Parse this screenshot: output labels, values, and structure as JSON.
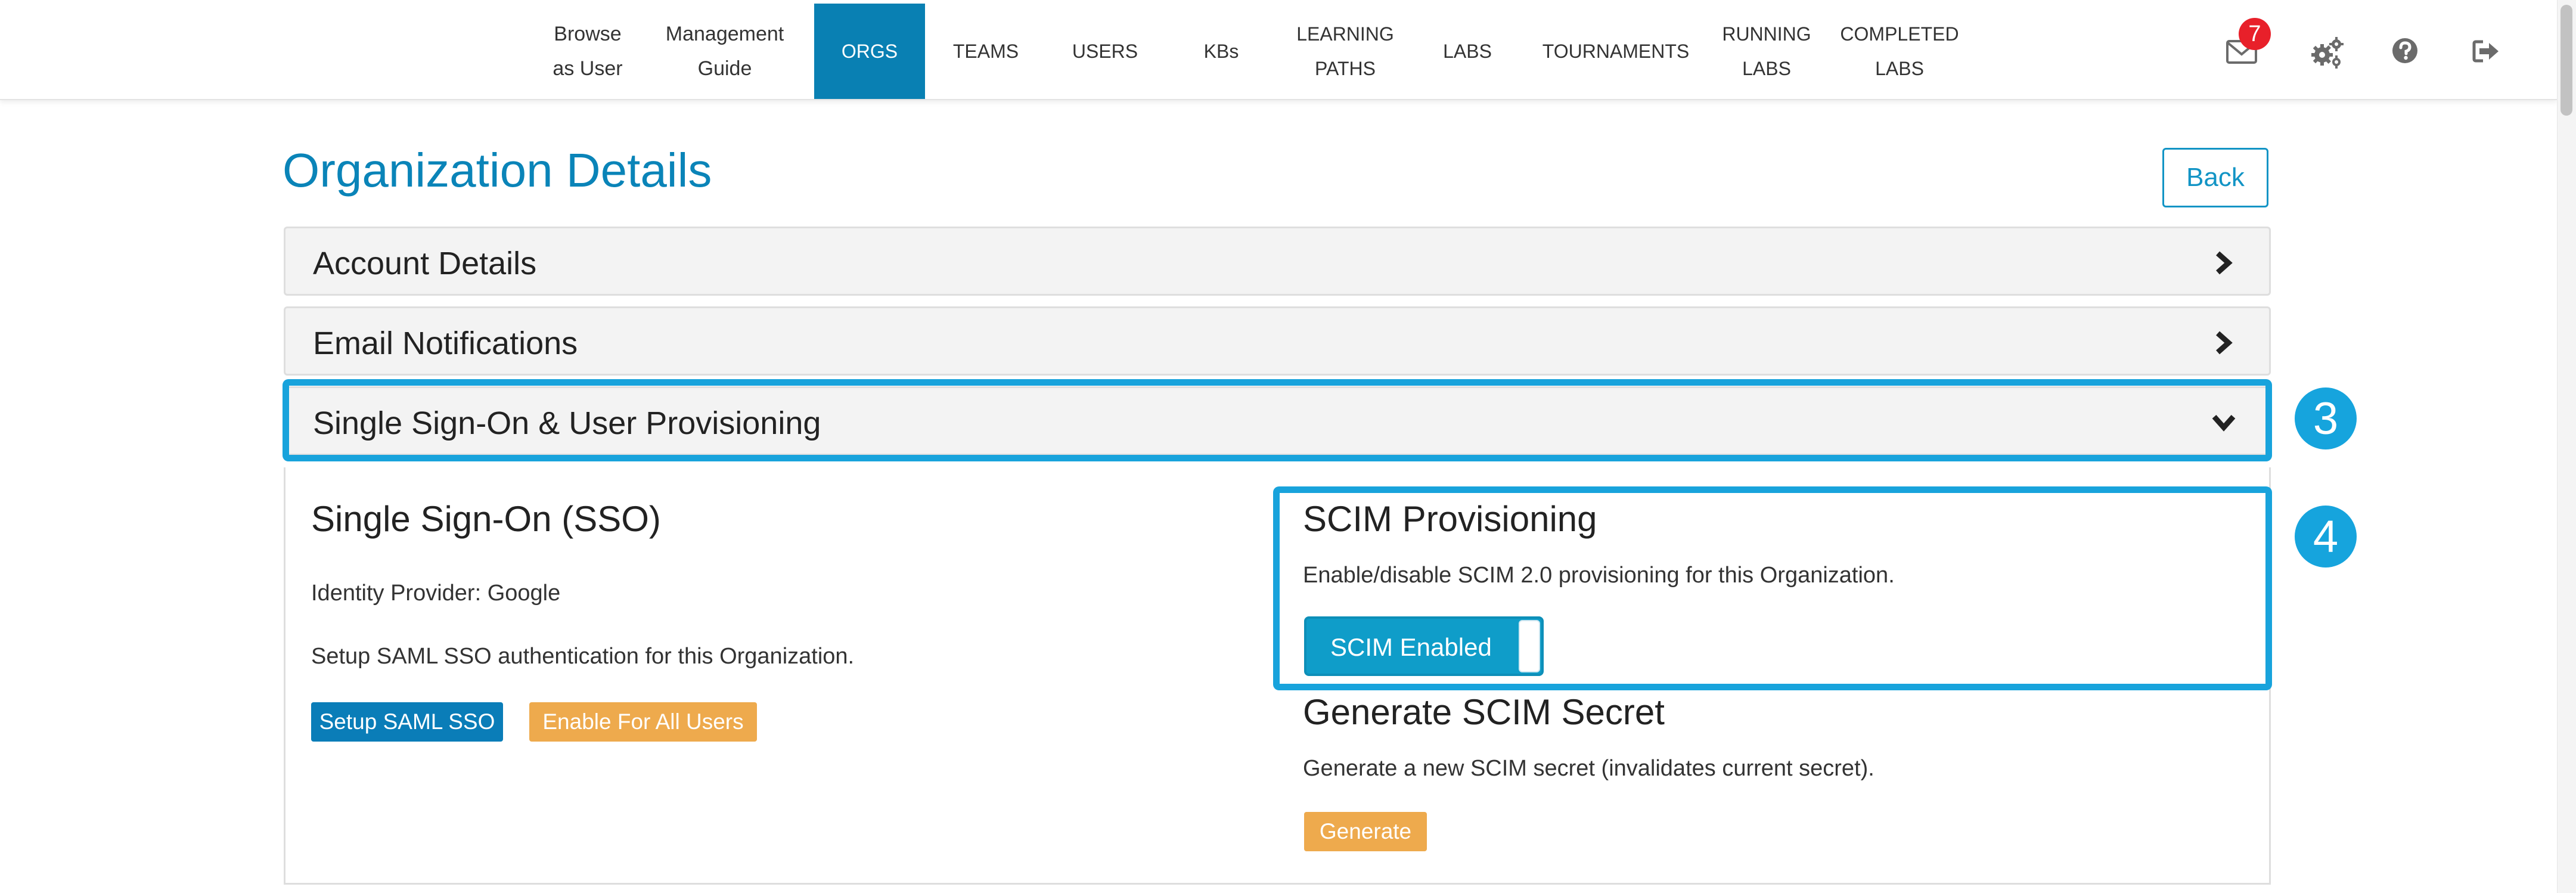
{
  "nav": {
    "items": [
      {
        "label": "Browse\nas User",
        "active": false
      },
      {
        "label": "Management\nGuide",
        "active": false
      },
      {
        "label": "ORGS",
        "active": true
      },
      {
        "label": "TEAMS",
        "active": false
      },
      {
        "label": "USERS",
        "active": false
      },
      {
        "label": "KBs",
        "active": false
      },
      {
        "label": "LEARNING\nPATHS",
        "active": false
      },
      {
        "label": "LABS",
        "active": false
      },
      {
        "label": "TOURNAMENTS",
        "active": false
      },
      {
        "label": "RUNNING\nLABS",
        "active": false
      },
      {
        "label": "COMPLETED\nLABS",
        "active": false
      }
    ],
    "mail_count": "7",
    "icons": [
      "mail-icon",
      "settings-gears-icon",
      "help-icon",
      "logout-icon"
    ],
    "active_color": "#0980b3"
  },
  "header": {
    "title": "Organization Details",
    "back_label": "Back"
  },
  "accordion": {
    "sections": [
      {
        "title": "Account Details",
        "expanded": false
      },
      {
        "title": "Email Notifications",
        "expanded": false
      },
      {
        "title": "Single Sign-On & User Provisioning",
        "expanded": true
      }
    ]
  },
  "sso": {
    "heading": "Single Sign-On (SSO)",
    "identity_provider": "Identity Provider: Google",
    "description": "Setup SAML SSO authentication for this Organization.",
    "setup_button": "Setup SAML SSO",
    "enable_all_button": "Enable For All Users"
  },
  "scim": {
    "heading": "SCIM Provisioning",
    "description": "Enable/disable SCIM 2.0 provisioning for this Organization.",
    "toggle_label": "SCIM Enabled",
    "toggle_on": true
  },
  "scim_secret": {
    "heading": "Generate SCIM Secret",
    "description": "Generate a new SCIM secret (invalidates current secret).",
    "generate_button": "Generate"
  },
  "callouts": {
    "step3": "3",
    "step4": "4",
    "color": "#18a3dc"
  }
}
